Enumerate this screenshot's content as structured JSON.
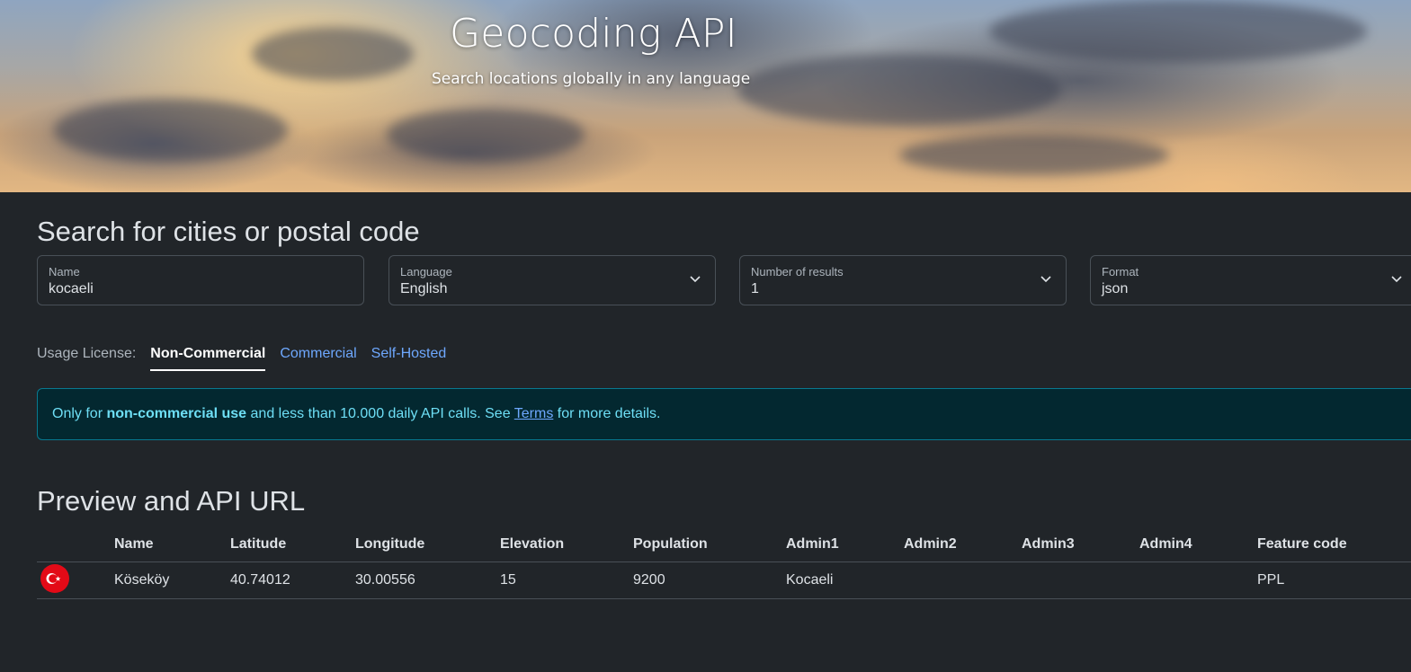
{
  "hero": {
    "title": "Geocoding API",
    "subtitle": "Search locations globally in any language"
  },
  "search": {
    "heading": "Search for cities or postal code",
    "fields": [
      {
        "label": "Name",
        "value": "kocaeli"
      },
      {
        "label": "Language",
        "value": "English"
      },
      {
        "label": "Number of results",
        "value": "1"
      },
      {
        "label": "Format",
        "value": "json"
      }
    ]
  },
  "license": {
    "label": "Usage License:",
    "tabs": [
      "Non-Commercial",
      "Commercial",
      "Self-Hosted"
    ],
    "active": "Non-Commercial"
  },
  "alert": {
    "prefix": "Only for ",
    "bold": "non-commercial use",
    "middle": " and less than 10.000 daily API calls. See ",
    "link": "Terms",
    "suffix": " for more details."
  },
  "preview": {
    "heading": "Preview and API URL",
    "columns": [
      "",
      "Name",
      "Latitude",
      "Longitude",
      "Elevation",
      "Population",
      "Admin1",
      "Admin2",
      "Admin3",
      "Admin4",
      "Feature code"
    ],
    "rows": [
      {
        "flag": "turkey-flag-icon",
        "name": "Köseköy",
        "latitude": "40.74012",
        "longitude": "30.00556",
        "elevation": "15",
        "population": "9200",
        "admin1": "Kocaeli",
        "admin2": "",
        "admin3": "",
        "admin4": "",
        "feature_code": "PPL"
      }
    ]
  },
  "colors": {
    "background": "#212529",
    "link": "#6ea8fe",
    "alert_text": "#6edff6",
    "flag_red": "#e30a17"
  }
}
